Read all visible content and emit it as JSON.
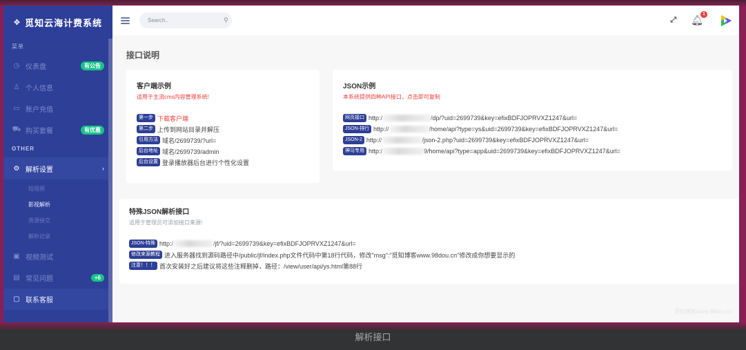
{
  "brand": {
    "icon": "move-icon",
    "title": "觅知云海计费系统"
  },
  "sidebar": {
    "section_menu": "菜单",
    "section_other": "OTHER",
    "items": [
      {
        "icon": "dashboard-icon",
        "label": "仪表盘",
        "badge": "有公告"
      },
      {
        "icon": "user-icon",
        "label": "个人信息"
      },
      {
        "icon": "card-icon",
        "label": "账户充值"
      },
      {
        "icon": "cart-icon",
        "label": "购买套餐",
        "badge": "有优惠"
      }
    ],
    "open_item": {
      "icon": "gear-icon",
      "label": "解析设置",
      "chevron": "›"
    },
    "submenu": [
      "短视频",
      "影视解析",
      "资源接交",
      "解析记录"
    ],
    "active_sub": "影视解析",
    "after_items": [
      {
        "icon": "video-icon",
        "label": "视频测试"
      },
      {
        "icon": "doc-icon",
        "label": "常见问题",
        "badge": "+6"
      },
      {
        "icon": "chat-icon",
        "label": "联系客服"
      }
    ]
  },
  "topbar": {
    "search_placeholder": "Search..",
    "notification_count": "1"
  },
  "page": {
    "title": "接口说明"
  },
  "client_card": {
    "title": "客户端示例",
    "subtitle": "适用于主流cms内容管理系统!",
    "rows": [
      {
        "tag": "第一步",
        "text": "下载客户端",
        "red": true
      },
      {
        "tag": "第二步",
        "text": "上传到网站目录并解压"
      },
      {
        "tag": "引用方法",
        "text": "域名/2699739/?url="
      },
      {
        "tag": "后台地址",
        "text": "域名/2699739/admin"
      },
      {
        "tag": "后台设置",
        "text": "登录播放器后台进行个性化设置"
      }
    ]
  },
  "json_card": {
    "title": "JSON示例",
    "subtitle": "本系统提供四种API接口，点击即可复制",
    "rows": [
      {
        "tag": "网页接口",
        "prefix": "http:/",
        "suffix": "/dp/?uid=2699739&key=efixBDFJOPRVXZ1247&url="
      },
      {
        "tag": "JSON-排行",
        "prefix": "http://",
        "suffix": "/home/api?type=ys&uid=2699739&key=efixBDFJOPRVXZ1247&url="
      },
      {
        "tag": "JSON-2",
        "prefix": "http://",
        "suffix": "/json-2.php?uid=2699739&key=efixBDFJOPRVXZ1247&url="
      },
      {
        "tag": "神马专用",
        "prefix": "http:/",
        "suffix": "9/home/api?type=app&uid=2699739&key=efixBDFJOPRVXZ1247&url="
      }
    ]
  },
  "special_card": {
    "title": "特殊JSON解析接口",
    "subtitle": "适用于管理员可添加接口来源!",
    "rows": [
      {
        "tag": "JSON-特殊",
        "prefix": "http:/",
        "suffix": "/jf/?uid=2699739&key=efixBDFJOPRVXZ1247&url="
      },
      {
        "tag": "修改来源教程",
        "text": "进入服务器找到源码路径中/public/jf/index.php文件代码中第18行代码，修改\"msg\":\"觅知博客www.98dou.cn\"修改成你想要显示的"
      },
      {
        "tag": "注意！！！",
        "text": "首次安装好之后建议将这些注释删掉，路径：/view/user/api/ys.html第88行"
      }
    ]
  },
  "watermark": "觅知博客www.98dou.cn",
  "caption": "解析接口"
}
